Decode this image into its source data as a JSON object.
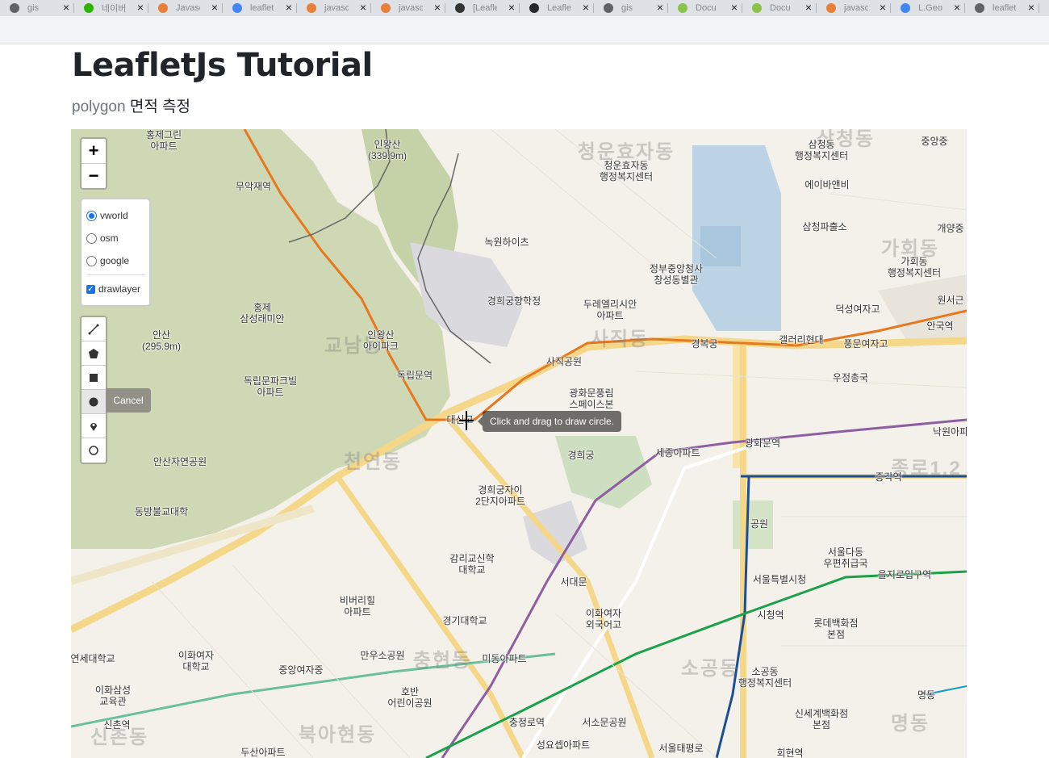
{
  "browser": {
    "tabs": [
      {
        "title": "gis",
        "color": "#5f6368"
      },
      {
        "title": "네이버",
        "color": "#2db400"
      },
      {
        "title": "Javascript",
        "color": "#e8803a"
      },
      {
        "title": "leaflet",
        "color": "#4285f4"
      },
      {
        "title": "javascript",
        "color": "#e8803a"
      },
      {
        "title": "javascript",
        "color": "#e8803a"
      },
      {
        "title": "[Leaflet]",
        "color": "#333333"
      },
      {
        "title": "Leaflet",
        "color": "#24292e"
      },
      {
        "title": "gis",
        "color": "#5f6368"
      },
      {
        "title": "Docu",
        "color": "#8bc34a"
      },
      {
        "title": "Docu",
        "color": "#8bc34a"
      },
      {
        "title": "javascript",
        "color": "#e8803a"
      },
      {
        "title": "L.Geo",
        "color": "#4285f4"
      },
      {
        "title": "leaflet",
        "color": "#5f6368"
      }
    ]
  },
  "page": {
    "title": "LeafletJs Tutorial",
    "subtitle_lead": "polygon",
    "subtitle_rest": " 면적 측정"
  },
  "map": {
    "zoom_in": "+",
    "zoom_out": "−",
    "layer_options": [
      "vworld",
      "osm",
      "google"
    ],
    "selected_layer": "vworld",
    "overlay_label": "drawlayer",
    "overlay_checked": true,
    "draw_tools": [
      "polyline-icon",
      "polygon-icon",
      "rectangle-icon",
      "circle-icon",
      "marker-icon",
      "circlemarker-icon"
    ],
    "active_tool": "circle-icon",
    "cancel_label": "Cancel",
    "tooltip": "Click and drag to draw circle.",
    "districts": [
      "청운효자동",
      "삼청동",
      "가회동",
      "사직동",
      "교남동",
      "천연동",
      "충현동",
      "소공동",
      "북아현동",
      "신촌동",
      "명동",
      "종로1.2"
    ],
    "labels": [
      "홍제그린\n아파트",
      "인왕산\n(339.9m)",
      "청운효자동\n행정복지센터",
      "삼청동\n행정복지센터",
      "중앙중",
      "무악재역",
      "에이바앤비",
      "삼청파출소",
      "개양중",
      "녹원하이츠",
      "정부중앙청사\n창성동별관",
      "가회동\n행정복지센터",
      "홍제\n삼성래미안",
      "경희궁향학정",
      "두레엘리시안\n아파트",
      "덕성여자고",
      "원서근",
      "안산\n(295.9m)",
      "인왕산\n아이파크",
      "사직공원",
      "경복궁",
      "갤러리현대",
      "풍문여자고",
      "안국역",
      "독립문파크빌\n아파트",
      "독립문역",
      "광화문풍림\n스페이스본",
      "우정총국",
      "대신고",
      "낙원아파",
      "안산자연공원",
      "경희궁",
      "세종아파트",
      "광화문역",
      "종각역",
      "동방불교대학",
      "경희궁자이\n2단지아파트",
      "공원",
      "감리교신학\n대학교",
      "서울다동\n우편취급국",
      "서울특별시청",
      "을지로입구역",
      "서대문",
      "비버리힐\n아파트",
      "이화여자\n외국어고",
      "시청역",
      "롯데백화점\n본점",
      "경기대학교",
      "이화여자\n대학교",
      "연세대학교",
      "만우소공원",
      "미동아파트",
      "중앙여자중",
      "이화삼성\n교육관",
      "호반\n어린이공원",
      "소공동\n행정복지센터",
      "신세계백화점\n본점",
      "명동",
      "신촌역",
      "충정로역",
      "서소문공원",
      "두산아파트",
      "성요셉아파트",
      "서울태평로",
      "회현역"
    ]
  }
}
